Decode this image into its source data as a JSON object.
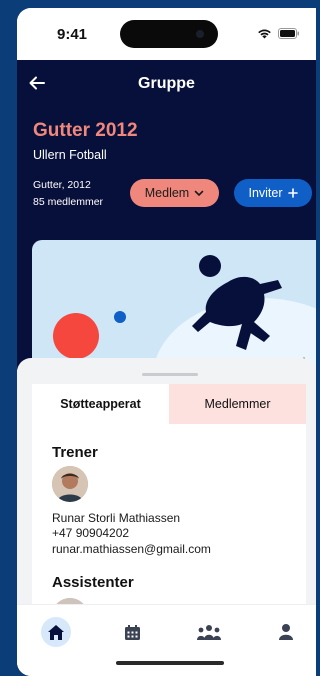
{
  "status_bar": {
    "time": "9:41",
    "icons": [
      "wifi-icon",
      "battery-icon"
    ]
  },
  "header": {
    "title": "Gruppe",
    "back_icon": "back-arrow-icon"
  },
  "group": {
    "name": "Gutter 2012",
    "club": "Ullern Fotball",
    "category": "Gutter, 2012",
    "member_count": "85 medlemmer",
    "member_button_label": "Medlem",
    "invite_button_label": "Inviter"
  },
  "tabs": [
    {
      "label": "Støtteapperat",
      "active": true
    },
    {
      "label": "Medlemmer",
      "active": false
    }
  ],
  "support_staff": {
    "trainer_heading": "Trener",
    "trainer": {
      "name": "Runar Storli Mathiassen",
      "phone": "+47 90904202",
      "email": "runar.mathiassen@gmail.com"
    },
    "assistants_heading": "Assistenter"
  },
  "bottom_nav": [
    {
      "icon": "home-icon",
      "active": true
    },
    {
      "icon": "calendar-icon",
      "active": false
    },
    {
      "icon": "group-icon",
      "active": false
    },
    {
      "icon": "profile-icon",
      "active": false
    }
  ],
  "colors": {
    "hero_background": "#07103a",
    "accent_coral": "#f0877c",
    "accent_blue": "#0f5fc7",
    "tab_inactive": "#fde1df"
  }
}
